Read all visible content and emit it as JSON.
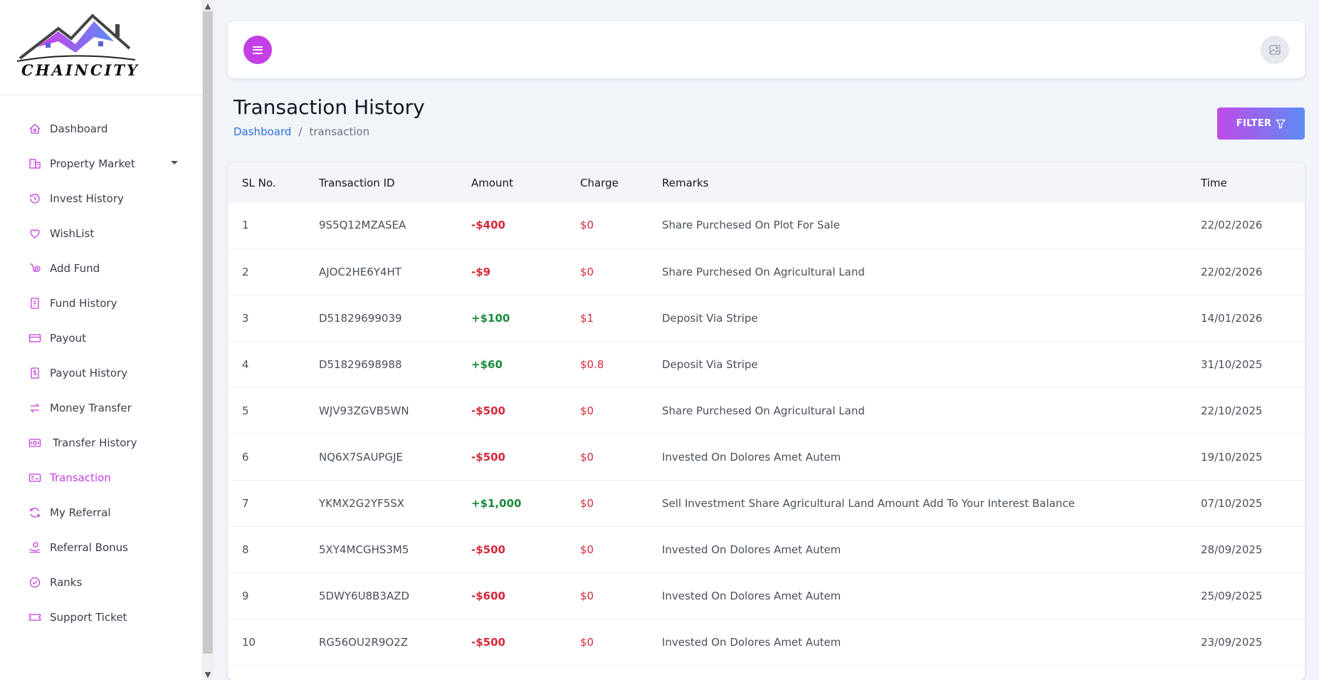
{
  "brand": {
    "logo_text": "CHAINCITY"
  },
  "sidebar": {
    "items": [
      {
        "label": "Dashboard",
        "icon": "home-icon"
      },
      {
        "label": "Property Market",
        "icon": "building-icon"
      },
      {
        "label": "Invest History",
        "icon": "history-icon"
      },
      {
        "label": "WishList",
        "icon": "heart-icon"
      },
      {
        "label": "Add Fund",
        "icon": "add-fund-icon"
      },
      {
        "label": "Fund History",
        "icon": "document-icon"
      },
      {
        "label": "Payout",
        "icon": "credit-card-icon"
      },
      {
        "label": "Payout History",
        "icon": "dollar-document-icon"
      },
      {
        "label": "Money Transfer",
        "icon": "transfer-arrows-icon"
      },
      {
        "label": "Transfer History",
        "icon": "cash-icon"
      },
      {
        "label": "Transaction",
        "icon": "receipt-icon"
      },
      {
        "label": "My Referral",
        "icon": "refresh-icon"
      },
      {
        "label": "Referral Bonus",
        "icon": "hand-coin-icon"
      },
      {
        "label": "Ranks",
        "icon": "badge-check-icon"
      },
      {
        "label": "Support Ticket",
        "icon": "ticket-icon"
      }
    ],
    "active_index": 10,
    "accent_color": "#c23ee0"
  },
  "header": {
    "page_title": "Transaction History",
    "breadcrumb": {
      "home": "Dashboard",
      "separator": "/",
      "current": "transaction"
    },
    "filter_label": "FILTER"
  },
  "table": {
    "columns": [
      "SL No.",
      "Transaction ID",
      "Amount",
      "Charge",
      "Remarks",
      "Time"
    ],
    "rows": [
      {
        "sl": "1",
        "trx_id": "9S5Q12MZASEA",
        "amount": "-$400",
        "sign": "neg",
        "charge": "$0",
        "remarks": "Share Purchesed On Plot For Sale",
        "time": "22/02/2026"
      },
      {
        "sl": "2",
        "trx_id": "AJOC2HE6Y4HT",
        "amount": "-$9",
        "sign": "neg",
        "charge": "$0",
        "remarks": "Share Purchesed On Agricultural Land",
        "time": "22/02/2026"
      },
      {
        "sl": "3",
        "trx_id": "D51829699039",
        "amount": "+$100",
        "sign": "pos",
        "charge": "$1",
        "remarks": "Deposit Via Stripe",
        "time": "14/01/2026"
      },
      {
        "sl": "4",
        "trx_id": "D51829698988",
        "amount": "+$60",
        "sign": "pos",
        "charge": "$0.8",
        "remarks": "Deposit Via Stripe",
        "time": "31/10/2025"
      },
      {
        "sl": "5",
        "trx_id": "WJV93ZGVB5WN",
        "amount": "-$500",
        "sign": "neg",
        "charge": "$0",
        "remarks": "Share Purchesed On Agricultural Land",
        "time": "22/10/2025"
      },
      {
        "sl": "6",
        "trx_id": "NQ6X7SAUPGJE",
        "amount": "-$500",
        "sign": "neg",
        "charge": "$0",
        "remarks": "Invested On Dolores Amet Autem",
        "time": "19/10/2025"
      },
      {
        "sl": "7",
        "trx_id": "YKMX2G2YF5SX",
        "amount": "+$1,000",
        "sign": "pos",
        "charge": "$0",
        "remarks": "Sell Investment Share Agricultural Land Amount Add To Your Interest Balance",
        "time": "07/10/2025"
      },
      {
        "sl": "8",
        "trx_id": "5XY4MCGHS3M5",
        "amount": "-$500",
        "sign": "neg",
        "charge": "$0",
        "remarks": "Invested On Dolores Amet Autem",
        "time": "28/09/2025"
      },
      {
        "sl": "9",
        "trx_id": "5DWY6U8B3AZD",
        "amount": "-$600",
        "sign": "neg",
        "charge": "$0",
        "remarks": "Invested On Dolores Amet Autem",
        "time": "25/09/2025"
      },
      {
        "sl": "10",
        "trx_id": "RG56OU2R9O2Z",
        "amount": "-$500",
        "sign": "neg",
        "charge": "$0",
        "remarks": "Invested On Dolores Amet Autem",
        "time": "23/09/2025"
      }
    ]
  },
  "colors": {
    "negative": "#d5283a",
    "positive": "#1b8a3c",
    "link": "#2f6fe0",
    "menu_button": "#c43fe6"
  }
}
